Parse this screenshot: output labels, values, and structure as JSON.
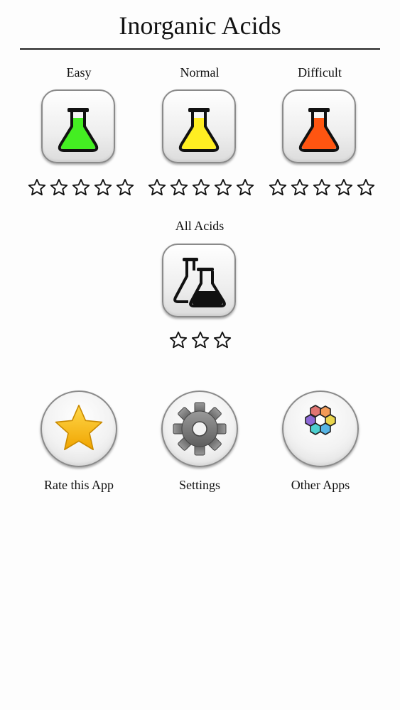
{
  "header": {
    "title": "Inorganic Acids"
  },
  "levels": [
    {
      "label": "Easy",
      "color": "#44ee22",
      "stars_earned": 0,
      "stars_total": 5
    },
    {
      "label": "Normal",
      "color": "#ffee22",
      "stars_earned": 0,
      "stars_total": 5
    },
    {
      "label": "Difficult",
      "color": "#ff5511",
      "stars_earned": 0,
      "stars_total": 5
    }
  ],
  "all_acids": {
    "label": "All Acids",
    "stars_earned": 0,
    "stars_total": 3
  },
  "menu": {
    "rate_label": "Rate this App",
    "settings_label": "Settings",
    "other_apps_label": "Other Apps"
  },
  "icons": {
    "level_flask": "flask-icon",
    "all_acids": "two-flasks-icon",
    "rate": "star-icon",
    "settings": "gear-icon",
    "other_apps": "hexagon-grid-icon",
    "rating": "empty-star-icon"
  }
}
